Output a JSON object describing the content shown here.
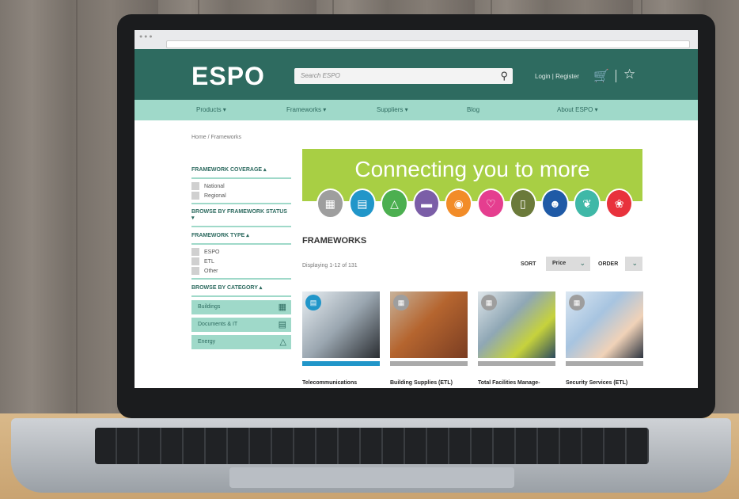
{
  "site": {
    "logo": "ESPO",
    "search_placeholder": "Search ESPO",
    "header_links": "Login | Register"
  },
  "nav": {
    "items": [
      {
        "label": "Products ▾"
      },
      {
        "label": "Frameworks ▾"
      },
      {
        "label": "Suppliers ▾"
      },
      {
        "label": "Blog"
      },
      {
        "label": "About ESPO ▾"
      }
    ]
  },
  "breadcrumb": "Home / Frameworks",
  "sidebar": {
    "coverage_heading": "FRAMEWORK COVERAGE ▴",
    "coverage_options": [
      "National",
      "Regional"
    ],
    "status_heading": "BROWSE BY FRAMEWORK STATUS ▾",
    "type_heading": "FRAMEWORK TYPE ▴",
    "type_options": [
      "ESPO",
      "ETL",
      "Other"
    ],
    "category_heading": "BROWSE BY CATEGORY ▴",
    "categories": [
      "Buildings",
      "Documents & IT",
      "Energy"
    ]
  },
  "banner": {
    "text": "Connecting you to more",
    "colors": [
      "#9e9e9e",
      "#2196c9",
      "#4caf50",
      "#7b5ea7",
      "#f28c28",
      "#e53e8f",
      "#6b7a3a",
      "#1f5aa6",
      "#3fb8a7",
      "#e8323c"
    ]
  },
  "main": {
    "title": "FRAMEWORKS",
    "displaying": "Displaying 1-12 of 131",
    "sort_label": "SORT",
    "sort_value": "Price",
    "order_label": "ORDER",
    "cards": [
      {
        "label": "Telecommunications"
      },
      {
        "label": "Building Supplies (ETL)"
      },
      {
        "label": "Total Facilities Manage-"
      },
      {
        "label": "Security Services (ETL)"
      }
    ]
  }
}
